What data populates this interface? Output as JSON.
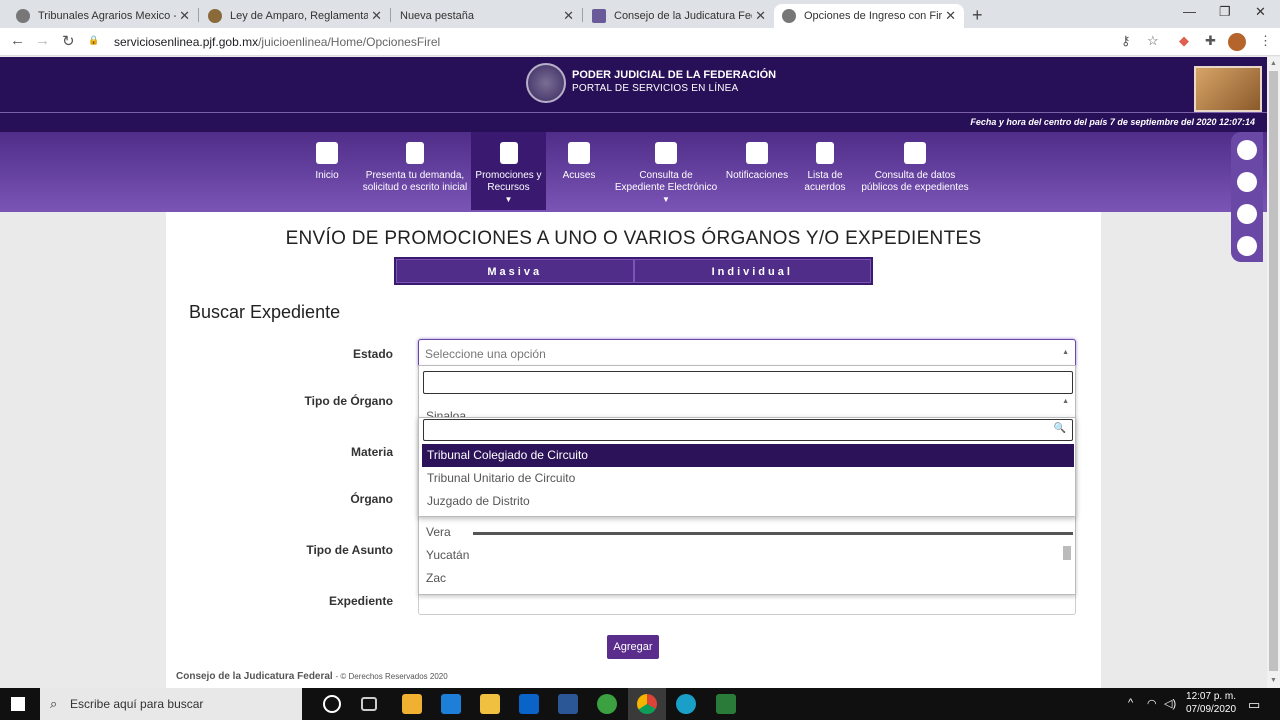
{
  "browser": {
    "tabs": [
      {
        "label": "Tribunales Agrarios Mexico - Cor",
        "icon": "globe-icon"
      },
      {
        "label": "Ley de Amparo, Reglamentaria d",
        "icon": "seal-icon"
      },
      {
        "label": "Nueva pestaña",
        "icon": ""
      },
      {
        "label": "Consejo de la Judicatura Federal",
        "icon": "cjf-icon"
      },
      {
        "label": "Opciones de Ingreso con Firel - I",
        "icon": "globe-icon"
      }
    ],
    "url_host": "serviciosenlinea.pjf.gob.mx",
    "url_path": "/juicioenlinea/Home/OpcionesFirel"
  },
  "header": {
    "line1": "PODER JUDICIAL DE LA FEDERACIÓN",
    "line2": "PORTAL DE SERVICIOS EN LÍNEA",
    "datetime": "Fecha y hora del centro del país 7 de septiembre del 2020 12:07:14"
  },
  "nav": {
    "items": [
      {
        "l1": "Inicio",
        "l2": ""
      },
      {
        "l1": "Presenta tu demanda,",
        "l2": "solicitud o escrito inicial"
      },
      {
        "l1": "Promociones y",
        "l2": "Recursos"
      },
      {
        "l1": "Acuses",
        "l2": ""
      },
      {
        "l1": "Consulta de",
        "l2": "Expediente Electrónico"
      },
      {
        "l1": "Notificaciones",
        "l2": ""
      },
      {
        "l1": "Lista de",
        "l2": "acuerdos"
      },
      {
        "l1": "Consulta de datos",
        "l2": "públicos de expedientes"
      }
    ]
  },
  "main": {
    "title": "ENVÍO DE PROMOCIONES A UNO O VARIOS ÓRGANOS Y/O EXPEDIENTES",
    "seg_masiva": "Masiva",
    "seg_individual": "Individual",
    "section": "Buscar Expediente",
    "labels": {
      "estado": "Estado",
      "tipo_organo": "Tipo de Órgano",
      "materia": "Materia",
      "organo": "Órgano",
      "tipo_asunto": "Tipo de Asunto",
      "expediente": "Expediente"
    },
    "estado_placeholder": "Seleccione una opción",
    "add_button": "Agregar"
  },
  "estado_dropdown": {
    "options": [
      "Sinaloa",
      "Vera",
      "Yucatán",
      "Zac"
    ]
  },
  "tipo_organo_dropdown": {
    "options": [
      "Tribunal Colegiado de Circuito",
      "Tribunal Unitario de Circuito",
      "Juzgado de Distrito"
    ],
    "selected_index": 0
  },
  "footer": {
    "org": "Consejo de la Judicatura Federal",
    "rights": "- © Derechos Reservados 2020"
  },
  "taskbar": {
    "search_placeholder": "Escribe aquí para buscar",
    "time": "12:07 p. m.",
    "date": "07/09/2020"
  },
  "colors": {
    "brand_dark": "#281058",
    "brand_mid": "#4f2d88",
    "selected": "#2c1359"
  }
}
